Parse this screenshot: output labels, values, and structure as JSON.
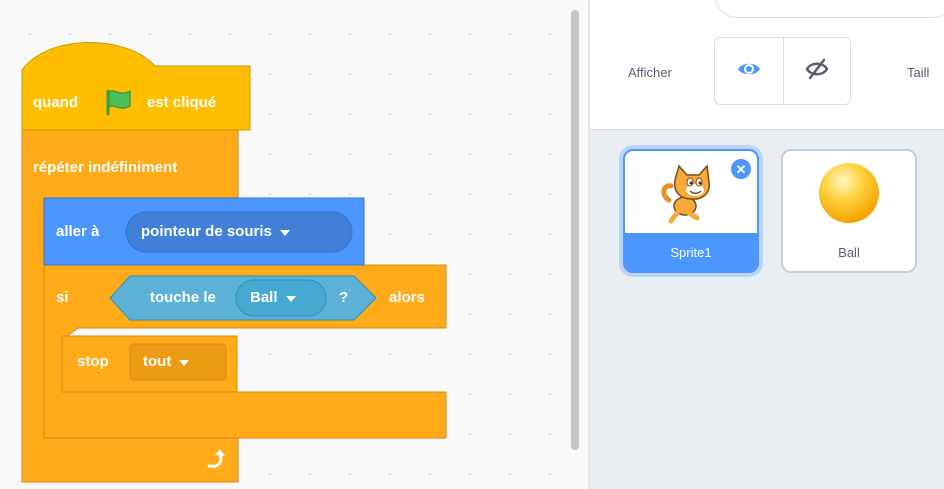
{
  "workspace": {
    "hat_block": {
      "prefix": "quand",
      "suffix": "est cliqué",
      "flag_icon": "green-flag-icon"
    },
    "forever_block": {
      "label": "répéter indéfiniment",
      "loop_icon": "loop-arrow-icon"
    },
    "goto_block": {
      "label": "aller à",
      "target": "pointeur de souris"
    },
    "if_block": {
      "label_if": "si",
      "label_then": "alors"
    },
    "touching_block": {
      "label": "touche le",
      "target": "Ball",
      "suffix": "?"
    },
    "stop_block": {
      "label": "stop",
      "option": "tout"
    }
  },
  "sprite_panel": {
    "show_label": "Afficher",
    "show_icon": "eye-icon",
    "hide_icon": "eye-slash-icon",
    "size_label": "Taill",
    "sprites": [
      {
        "name": "Sprite1",
        "selected": true,
        "thumbnail": "cat-sprite"
      },
      {
        "name": "Ball",
        "selected": false,
        "thumbnail": "ball-sprite"
      }
    ],
    "delete_icon": "close-icon"
  },
  "colors": {
    "events": "#ffbf00",
    "control": "#ffab19",
    "motion": "#4c97ff",
    "sensing": "#5cb1d6",
    "accent": "#4c97ff"
  }
}
